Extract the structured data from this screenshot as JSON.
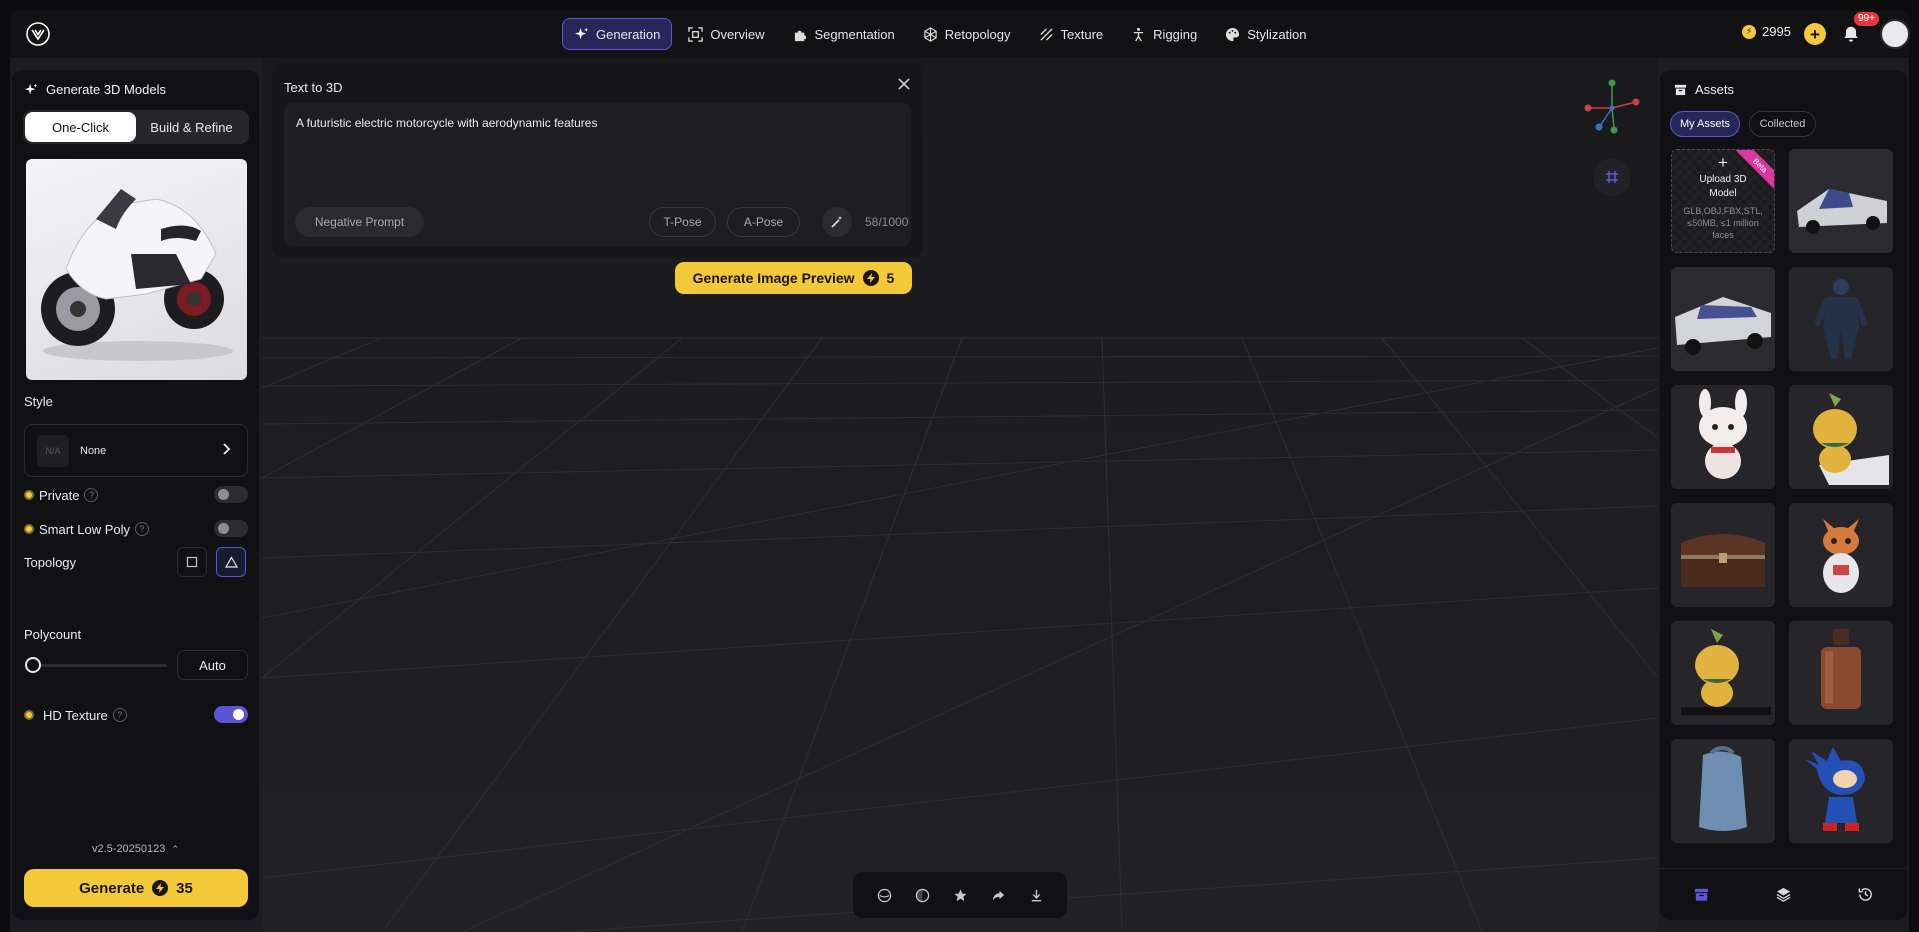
{
  "topbar": {
    "nav": [
      {
        "label": "Generation",
        "icon": "sparkle-icon",
        "active": true
      },
      {
        "label": "Overview",
        "icon": "scan-icon"
      },
      {
        "label": "Segmentation",
        "icon": "puzzle-icon"
      },
      {
        "label": "Retopology",
        "icon": "mesh-icon"
      },
      {
        "label": "Texture",
        "icon": "texture-icon"
      },
      {
        "label": "Rigging",
        "icon": "rig-icon"
      },
      {
        "label": "Stylization",
        "icon": "palette-icon"
      }
    ],
    "credits": "2995",
    "notification_badge": "99+"
  },
  "left_panel": {
    "title": "Generate 3D Models",
    "modes": [
      "One-Click",
      "Build & Refine"
    ],
    "active_mode": "One-Click",
    "style_label": "Style",
    "style_thumb": "N/A",
    "style_value": "None",
    "private_label": "Private",
    "smart_low_poly_label": "Smart Low Poly",
    "topology_label": "Topology",
    "polycount_label": "Polycount",
    "polycount_value": "Auto",
    "hd_texture_label": "HD Texture",
    "version": "v2.5-20250123",
    "generate_label": "Generate",
    "generate_cost": "35"
  },
  "text_to_3d": {
    "title": "Text to 3D",
    "prompt": "A futuristic electric motorcycle with aerodynamic features",
    "negative_prompt_label": "Negative Prompt",
    "t_pose_label": "T-Pose",
    "a_pose_label": "A-Pose",
    "char_count": "58/1000",
    "preview_button_label": "Generate Image Preview",
    "preview_cost": "5"
  },
  "assets": {
    "title": "Assets",
    "tabs": [
      "My Assets",
      "Collected"
    ],
    "active_tab": "My Assets",
    "upload_title": "Upload 3D Model",
    "upload_formats": "GLB,OBJ,FBX,STL, ≤50MB, ≤1 million faces",
    "upload_ribbon": "Beta"
  },
  "colors": {
    "accent": "#5b57d8",
    "cta": "#f3c93a",
    "panel": "#111113",
    "badge": "#e5373e"
  }
}
